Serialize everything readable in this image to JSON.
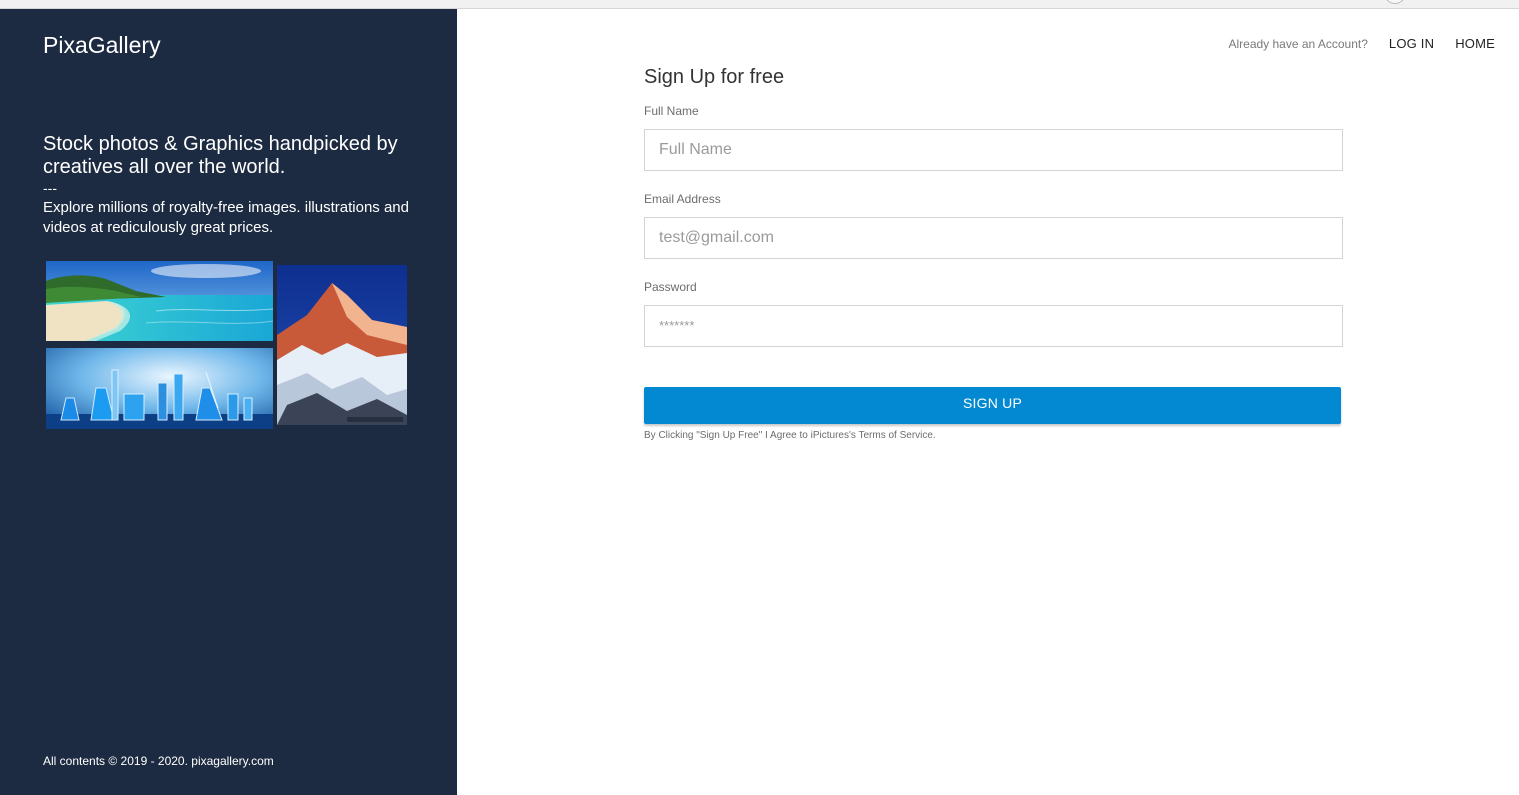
{
  "left_panel": {
    "brand": "PixaGallery",
    "tagline": "Stock photos & Graphics handpicked by creatives all over the world.",
    "separator": "---",
    "description": "Explore millions of royalty-free images. illustrations and videos at rediculously great prices.",
    "copyright": "All contents © 2019 - 2020. pixagallery.com"
  },
  "top_nav": {
    "account_question": "Already have an Account?",
    "login": "LOG IN",
    "home": "HOME"
  },
  "form": {
    "title": "Sign Up for free",
    "full_name_label": "Full Name",
    "full_name_placeholder": "Full Name",
    "email_label": "Email Address",
    "email_placeholder": "test@gmail.com",
    "password_label": "Password",
    "password_placeholder": "*******",
    "submit": "SIGN UP",
    "terms": "By Clicking \"Sign Up Free\" I Agree to iPictures's Terms of Service."
  },
  "colors": {
    "panel_bg": "#1c2b41",
    "button_bg": "#0289d1"
  }
}
